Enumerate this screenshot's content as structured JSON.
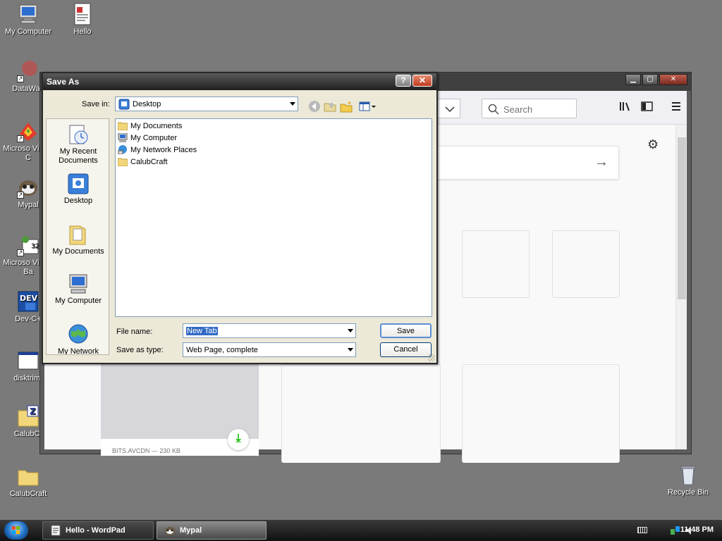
{
  "desktop": {
    "icons": [
      {
        "label": "My Computer"
      },
      {
        "label": "Hello"
      },
      {
        "label": "DataWag"
      },
      {
        "label": "Microso Visual C"
      },
      {
        "label": "Mypal"
      },
      {
        "label": "Microso Visual Ba"
      },
      {
        "label": "Dev-C+"
      },
      {
        "label": "disktrim-"
      },
      {
        "label": "CalubCr"
      },
      {
        "label": "CalubCraft"
      },
      {
        "label": "Recycle Bin"
      }
    ]
  },
  "browser": {
    "search_placeholder": "Search",
    "arrow": "→",
    "download_caption": "BITS.AVCDN — 230 KB"
  },
  "dialog": {
    "title": "Save As",
    "help": "?",
    "close": "✕",
    "save_in_label": "Save in:",
    "save_in_value": "Desktop",
    "places": [
      {
        "label": "My Recent Documents"
      },
      {
        "label": "Desktop"
      },
      {
        "label": "My Documents"
      },
      {
        "label": "My Computer"
      },
      {
        "label": "My Network"
      }
    ],
    "files": [
      {
        "name": "My Documents"
      },
      {
        "name": "My Computer"
      },
      {
        "name": "My Network Places"
      },
      {
        "name": "CalubCraft"
      }
    ],
    "file_name_label": "File name:",
    "file_name_value": "New Tab",
    "save_as_type_label": "Save as type:",
    "save_as_type_value": "Web Page, complete",
    "save_button": "Save",
    "cancel_button": "Cancel"
  },
  "taskbar": {
    "tasks": [
      {
        "label": "Hello - WordPad"
      },
      {
        "label": "Mypal"
      }
    ],
    "clock": "11:48 PM"
  }
}
